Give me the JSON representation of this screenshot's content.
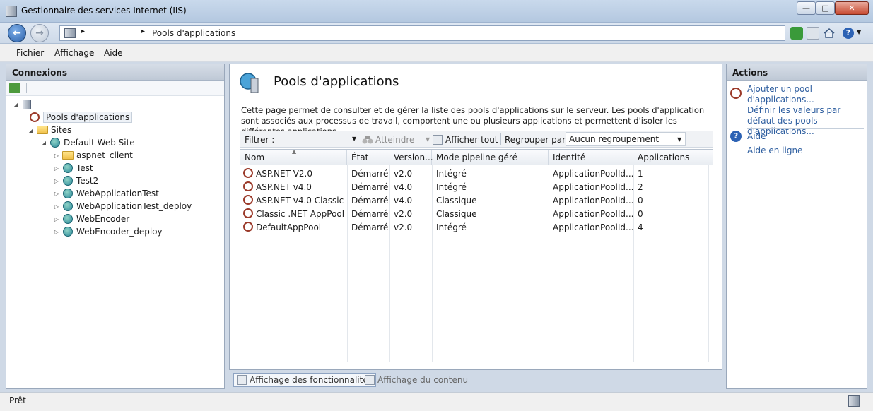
{
  "window": {
    "title": "Gestionnaire des services Internet (IIS)"
  },
  "address": {
    "separator": "▸",
    "path_label": "Pools d'applications"
  },
  "menu": {
    "fichier": "Fichier",
    "affichage": "Affichage",
    "aide": "Aide"
  },
  "connections": {
    "header": "Connexions",
    "tree": [
      {
        "label": "Pools d'applications"
      },
      {
        "label": "Sites"
      },
      {
        "label": "Default Web Site"
      },
      {
        "label": "aspnet_client"
      },
      {
        "label": "Test"
      },
      {
        "label": "Test2"
      },
      {
        "label": "WebApplicationTest"
      },
      {
        "label": "WebApplicationTest_deploy"
      },
      {
        "label": "WebEncoder"
      },
      {
        "label": "WebEncoder_deploy"
      }
    ]
  },
  "main": {
    "title": "Pools d'applications",
    "description": "Cette page permet de consulter et de gérer la liste des pools d'applications sur le serveur. Les pools d'application sont associés aux processus de travail, comportent une ou plusieurs applications et permettent d'isoler les différentes applications.",
    "filter_label": "Filtrer :",
    "filter_value": "",
    "go_label": "Atteindre",
    "show_all_label": "Afficher tout",
    "group_label": "Regrouper par :",
    "group_value": "Aucun regroupement",
    "columns": [
      "Nom",
      "État",
      "Version...",
      "Mode pipeline géré",
      "Identité",
      "Applications"
    ],
    "rows": [
      [
        "ASP.NET V2.0",
        "Démarré",
        "v2.0",
        "Intégré",
        "ApplicationPoolId...",
        "1"
      ],
      [
        "ASP.NET v4.0",
        "Démarré",
        "v4.0",
        "Intégré",
        "ApplicationPoolId...",
        "2"
      ],
      [
        "ASP.NET v4.0 Classic",
        "Démarré",
        "v4.0",
        "Classique",
        "ApplicationPoolId...",
        "0"
      ],
      [
        "Classic .NET AppPool",
        "Démarré",
        "v2.0",
        "Classique",
        "ApplicationPoolId...",
        "0"
      ],
      [
        "DefaultAppPool",
        "Démarré",
        "v2.0",
        "Intégré",
        "ApplicationPoolId...",
        "4"
      ]
    ],
    "tabs": {
      "features": "Affichage des fonctionnalités",
      "content": "Affichage du contenu"
    }
  },
  "actions": {
    "header": "Actions",
    "add_pool": "Ajouter un pool d'applications...",
    "set_defaults": "Définir les valeurs par défaut des pools d'applications...",
    "help": "Aide",
    "online_help": "Aide en ligne"
  },
  "status": {
    "text": "Prêt"
  }
}
